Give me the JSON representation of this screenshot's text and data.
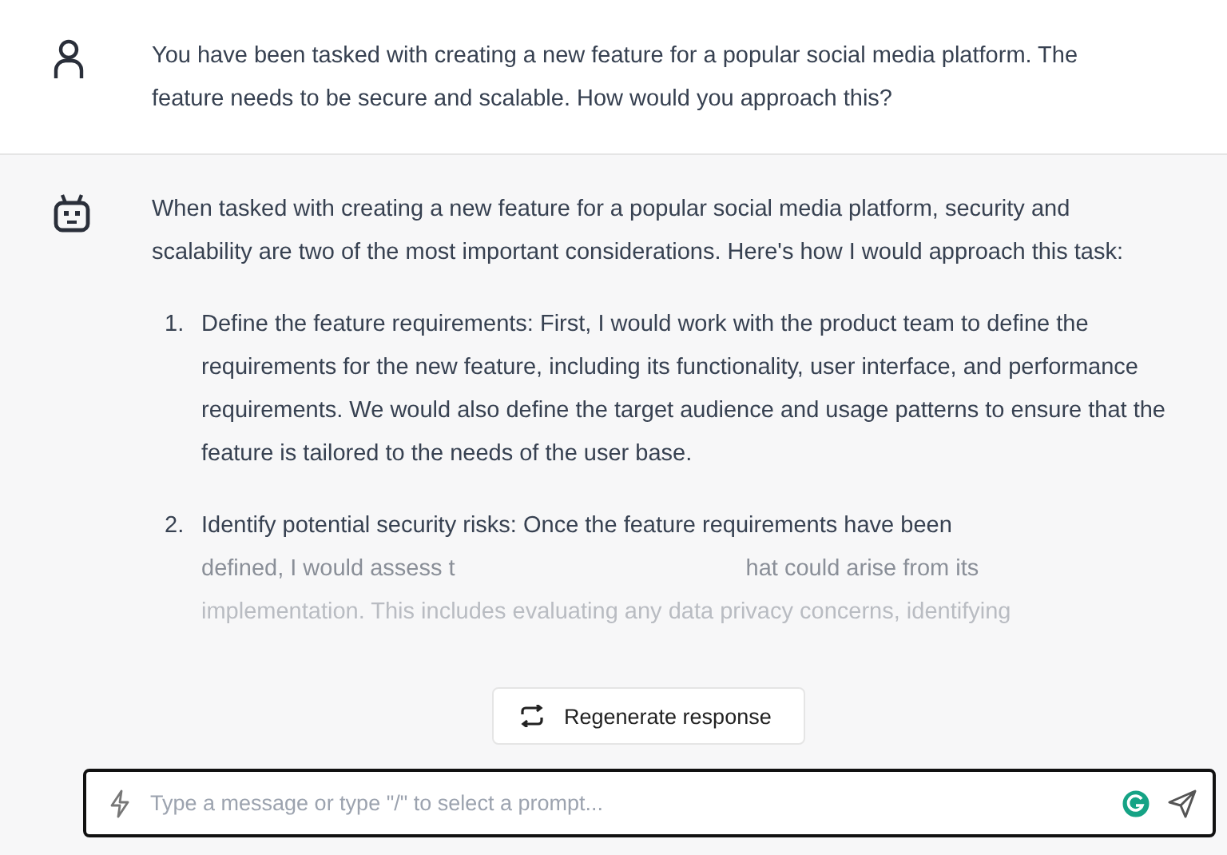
{
  "messages": [
    {
      "kind": "user",
      "paragraphs": [
        "You have been tasked with creating a new feature for a popular social media platform. The feature needs to be secure and scalable. How would you approach this?"
      ]
    },
    {
      "kind": "assistant",
      "paragraphs": [
        "When tasked with creating a new feature for a popular social media platform, security and scalability are two of the most important considerations. Here's how I would approach this task:"
      ],
      "list": [
        {
          "number": "1.",
          "text": "Define the feature requirements: First, I would work with the product team to define the requirements for the new feature, including its functionality, user interface, and performance requirements. We would also define the target audience and usage patterns to ensure that the feature is tailored to the needs of the user base."
        },
        {
          "number": "2.",
          "lines": [
            [
              "Identify potential security risks: Once the feature requirements have been"
            ],
            [
              "defined, I would assess t",
              "hat could arise from its"
            ],
            [
              "implementation. This includes evaluating any data privacy concerns, identifying"
            ]
          ]
        }
      ]
    }
  ],
  "regenerate_button": {
    "label": "Regenerate response"
  },
  "composer": {
    "placeholder": "Type a message or type \"/\" to select a prompt..."
  }
}
